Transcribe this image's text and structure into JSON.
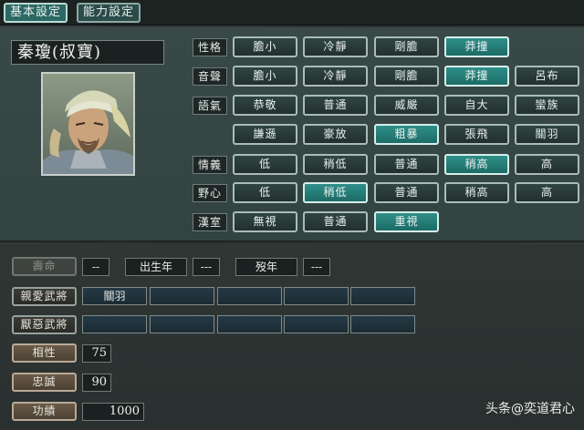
{
  "tabs": [
    {
      "label": "基本設定"
    },
    {
      "label": "能力設定"
    }
  ],
  "character": {
    "name": "秦瓊(叔寶)"
  },
  "attributes": {
    "temperament": {
      "label": "性格",
      "options": [
        "膽小",
        "冷靜",
        "剛膽",
        "莽撞"
      ],
      "selected": "莽撞"
    },
    "voice": {
      "label": "音聲",
      "options": [
        "膽小",
        "冷靜",
        "剛膽",
        "莽撞",
        "呂布"
      ],
      "selected": "莽撞"
    },
    "tone": {
      "label": "語氣",
      "options": [
        "恭敬",
        "普通",
        "威嚴",
        "自大",
        "蠻族",
        "謙遜",
        "豪放",
        "粗暴",
        "張飛",
        "關羽"
      ],
      "selected": "粗暴"
    },
    "loyalty_feeling": {
      "label": "情義",
      "options": [
        "低",
        "稍低",
        "普通",
        "稍高",
        "高"
      ],
      "selected": "稍高"
    },
    "ambition": {
      "label": "野心",
      "options": [
        "低",
        "稍低",
        "普通",
        "稍高",
        "高"
      ],
      "selected": "稍低"
    },
    "han": {
      "label": "漢室",
      "options": [
        "無視",
        "普通",
        "重視"
      ],
      "selected": "重視"
    }
  },
  "details": {
    "lifespan_label": "壽命",
    "lifespan_value": "--",
    "birth_label": "出生年",
    "birth_value": "---",
    "death_label": "歿年",
    "death_value": "---",
    "favored_label": "親愛武將",
    "favored": [
      "關羽",
      "",
      "",
      "",
      ""
    ],
    "disliked_label": "厭惡武將",
    "disliked": [
      "",
      "",
      "",
      "",
      ""
    ],
    "affinity_label": "相性",
    "affinity": 75,
    "loyalty_label": "忠誠",
    "loyalty": 90,
    "merit_label": "功績",
    "merit": 1000
  },
  "watermark": "头条@奕道君心"
}
